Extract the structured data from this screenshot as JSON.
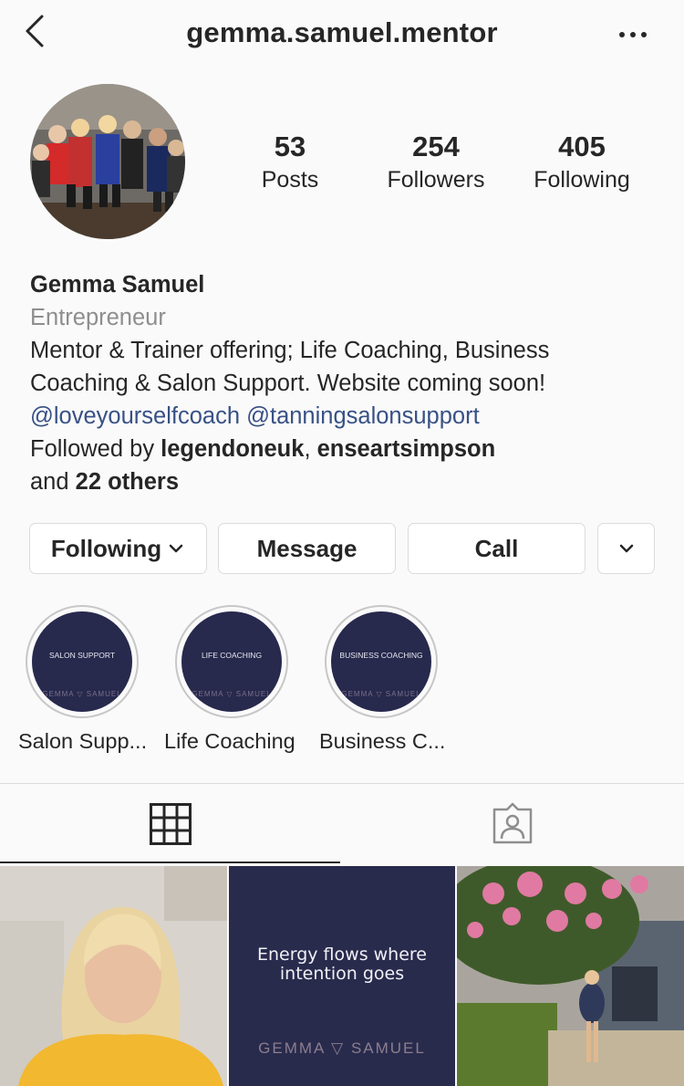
{
  "header": {
    "username": "gemma.samuel.mentor",
    "back_icon": "chevron-left-icon",
    "more_icon": "more-horizontal-icon"
  },
  "profile": {
    "avatar_icon": "group-photo",
    "stats": [
      {
        "value": "53",
        "label": "Posts"
      },
      {
        "value": "254",
        "label": "Followers"
      },
      {
        "value": "405",
        "label": "Following"
      }
    ]
  },
  "bio": {
    "name": "Gemma Samuel",
    "category": "Entrepreneur",
    "line1": "Mentor & Trainer offering; Life Coaching, Business",
    "line2": "Coaching & Salon Support. Website coming soon!",
    "mention1": "@loveyourselfcoach",
    "mention2": "@tanningsalonsupport",
    "followed_by_prefix": "Followed by ",
    "follower1": "legendoneuk",
    "separator": ", ",
    "follower2": "enseartsimpson",
    "and_prefix": "and ",
    "others": "22 others"
  },
  "actions": {
    "following": "Following",
    "message": "Message",
    "call": "Call"
  },
  "highlights": [
    {
      "cover_text": "SALON SUPPORT",
      "brand": "GEMMA ▽ SAMUEL",
      "label": "Salon Supp..."
    },
    {
      "cover_text": "LIFE COACHING",
      "brand": "GEMMA ▽ SAMUEL",
      "label": "Life Coaching"
    },
    {
      "cover_text": "BUSINESS COACHING",
      "brand": "GEMMA ▽ SAMUEL",
      "label": "Business C..."
    }
  ],
  "tabs": {
    "grid_icon": "grid-icon",
    "tagged_icon": "tagged-person-icon"
  },
  "posts": [
    {
      "kind": "photo"
    },
    {
      "kind": "quote",
      "quote_line1": "Energy flows where",
      "quote_line2": "intention goes",
      "brand": "GEMMA ▽ SAMUEL"
    },
    {
      "kind": "photo"
    }
  ],
  "colors": {
    "background": "#fafafa",
    "text": "#262626",
    "secondary": "#8e8e8e",
    "link": "#385185",
    "highlight_navy": "#27294d",
    "border": "#dbdbdb"
  }
}
